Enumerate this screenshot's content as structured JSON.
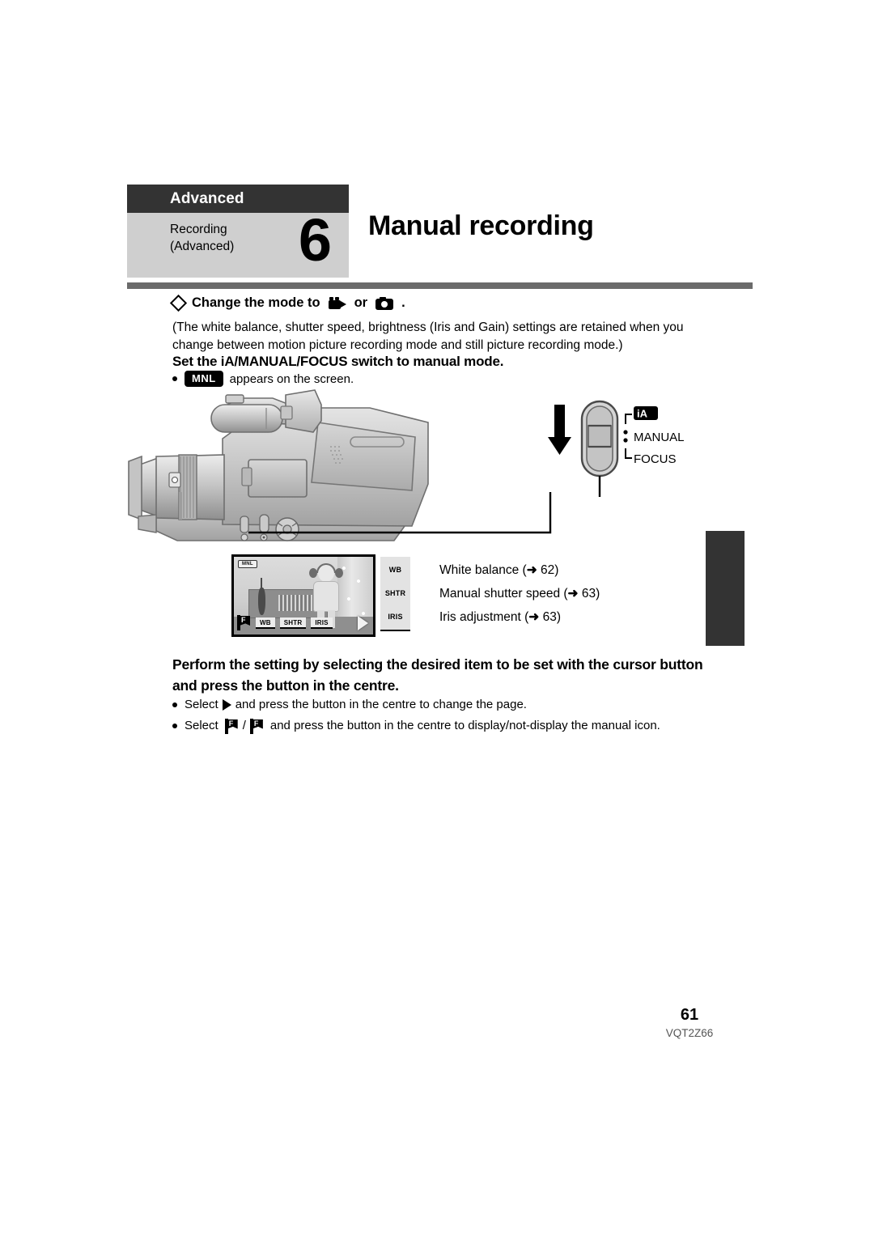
{
  "chapter_tab": {
    "section_label": "Advanced",
    "category_line1": "Recording",
    "category_line2": "(Advanced)",
    "chapter_number": "6"
  },
  "page_title": "Manual recording",
  "mode_line": {
    "prefix": "Change the mode to",
    "icon_video": "video-camera-icon",
    "conjunction": "or",
    "icon_photo": "still-camera-icon",
    "suffix": "."
  },
  "note_paragraph": "(The white balance, shutter speed, brightness (Iris and Gain) settings are retained when you change between motion picture recording mode and still picture recording mode.)",
  "subheading": "Set the iA/MANUAL/FOCUS switch to manual mode.",
  "mnl_note": {
    "badge": "MNL",
    "text": "appears on the screen."
  },
  "switch": {
    "positions": [
      "iA",
      "MANUAL",
      "FOCUS"
    ],
    "ia_label": "iA",
    "manual_label": "MANUAL",
    "focus_label": "FOCUS"
  },
  "lcd": {
    "osd_badge": "MNL",
    "buttons": [
      "WB",
      "SHTR",
      "IRIS"
    ],
    "left_icon": "manual-flag-icon",
    "right_icon": "page-next-arrow-icon"
  },
  "legend": [
    {
      "tag": "WB",
      "label": "White balance",
      "arrow": "➜",
      "page": "62"
    },
    {
      "tag": "SHTR",
      "label": "Manual shutter speed",
      "arrow": "➜",
      "page": "63"
    },
    {
      "tag": "IRIS",
      "label": "Iris adjustment",
      "arrow": "➜",
      "page": "63"
    }
  ],
  "instruction": "Perform the setting by selecting the desired item to be set with the cursor button and press the button in the centre.",
  "bullets": [
    {
      "pre": "Select",
      "icon": "right-triangle-icon",
      "post": "and press the button in the centre to change the page."
    },
    {
      "pre": "Select",
      "icon1": "manual-flag-off-icon",
      "separator": "/",
      "icon2": "manual-flag-on-icon",
      "post": "and press the button in the centre to display/not-display the manual icon."
    }
  ],
  "footer": {
    "page_number": "61",
    "document_code": "VQT2Z66"
  },
  "colors": {
    "tab_dark": "#333333",
    "tab_light": "#cfcfcf",
    "rule_gray": "#6b6b6b",
    "edge_tab": "#333333"
  }
}
